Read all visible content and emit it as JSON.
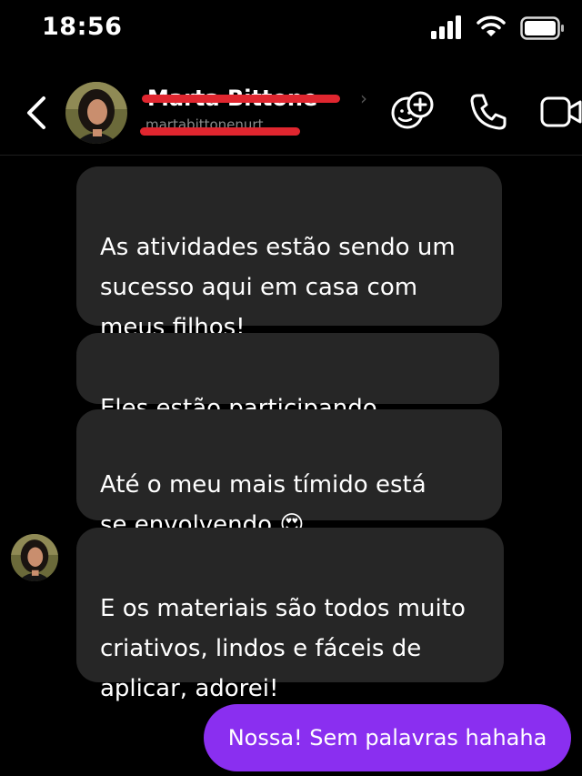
{
  "status": {
    "time": "18:56"
  },
  "contact": {
    "name": "Marta Bittone",
    "username": "martabittonenurt"
  },
  "messages": [
    {
      "text": "As atividades estão sendo um\nsucesso aqui em casa com\nmeus filhos!"
    },
    {
      "text": "Eles estão participando bastante"
    },
    {
      "text": "Até o meu mais tímido está\nse envolvendo 😍"
    },
    {
      "text": "E os materiais são todos muito\ncriativos, lindos e fáceis de\naplicar, adorei!"
    }
  ],
  "outgoing": {
    "text": "Nossa! Sem palavras hahaha"
  },
  "colors": {
    "background": "#000000",
    "incoming_bubble": "#262626",
    "outgoing_bubble": "#8a2ff0",
    "redaction": "#e0262f"
  },
  "icons": [
    "back-chevron-icon",
    "add-people-icon",
    "phone-icon",
    "video-camera-icon",
    "signal-icon",
    "wifi-icon",
    "battery-icon"
  ]
}
